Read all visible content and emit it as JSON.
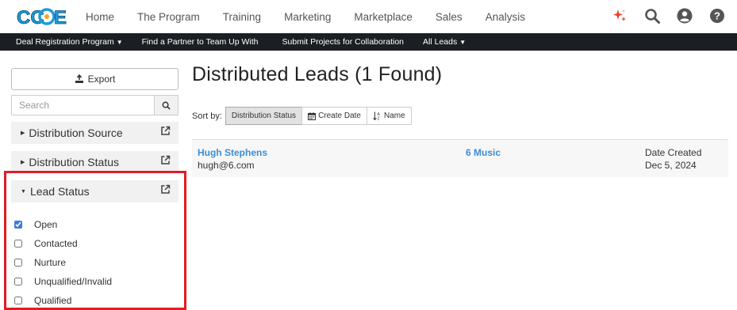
{
  "brand": {
    "logo_text": "CCOE"
  },
  "top_nav": {
    "items": [
      {
        "label": "Home"
      },
      {
        "label": "The Program"
      },
      {
        "label": "Training"
      },
      {
        "label": "Marketing"
      },
      {
        "label": "Marketplace"
      },
      {
        "label": "Sales"
      },
      {
        "label": "Analysis"
      }
    ],
    "icons": [
      "sparkle-icon",
      "search-icon",
      "user-icon",
      "help-icon"
    ]
  },
  "sub_nav": {
    "items": [
      {
        "label": "Deal Registration Program",
        "has_caret": true
      },
      {
        "label": "Find a Partner to Team Up With",
        "has_caret": false
      },
      {
        "label": "Submit Projects for Collaboration",
        "has_caret": false
      },
      {
        "label": "All Leads",
        "has_caret": true
      }
    ]
  },
  "sidebar": {
    "export_label": "Export",
    "search_placeholder": "Search",
    "facets": [
      {
        "label": "Distribution Source",
        "expanded": false
      },
      {
        "label": "Distribution Status",
        "expanded": false
      },
      {
        "label": "Lead Status",
        "expanded": true
      }
    ],
    "lead_status_options": [
      {
        "label": "Open",
        "checked": true
      },
      {
        "label": "Contacted",
        "checked": false
      },
      {
        "label": "Nurture",
        "checked": false
      },
      {
        "label": "Unqualified/Invalid",
        "checked": false
      },
      {
        "label": "Qualified",
        "checked": false
      }
    ]
  },
  "main": {
    "title": "Distributed Leads",
    "count_text": "(1 Found)",
    "sort_label": "Sort by:",
    "sort_options": [
      {
        "label": "Distribution Status",
        "active": true,
        "icon": ""
      },
      {
        "label": "Create Date",
        "active": false,
        "icon": "calendar-icon"
      },
      {
        "label": "Name",
        "active": false,
        "icon": "sort-alpha-icon"
      }
    ],
    "results": [
      {
        "name": "Hugh Stephens",
        "email": "hugh@6.com",
        "company": "6 Music",
        "date_label": "Date Created",
        "date": "Dec 5, 2024"
      }
    ]
  },
  "colors": {
    "link": "#3a8fd6",
    "subnav_bg": "#1b1f24",
    "highlight": "#e31b23",
    "sparkle": "#e8412c"
  }
}
